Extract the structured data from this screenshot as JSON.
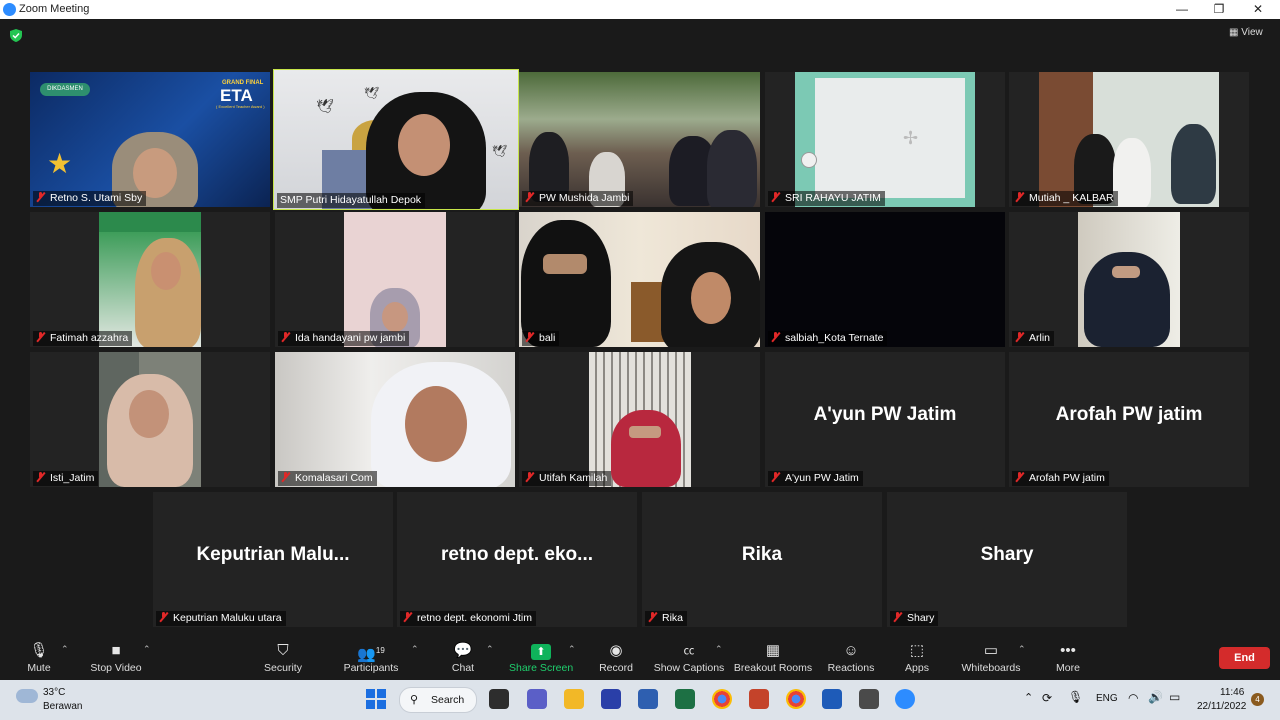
{
  "window": {
    "title": "Zoom Meeting",
    "min": "—",
    "max": "❐",
    "close": "✕"
  },
  "top": {
    "view_label": "View"
  },
  "tiles": [
    {
      "name": "Retno S. Utami Sby"
    },
    {
      "name": "SMP Putri Hidayatullah Depok"
    },
    {
      "name": "PW Mushida Jambi"
    },
    {
      "name": "SRI RAHAYU JATIM"
    },
    {
      "name": "Mutiah _ KALBAR"
    },
    {
      "name": "Fatimah azzahra"
    },
    {
      "name": "Ida handayani pw jambi"
    },
    {
      "name": "bali"
    },
    {
      "name": "salbiah_Kota Ternate"
    },
    {
      "name": "Arlin"
    },
    {
      "name": "Isti_Jatim"
    },
    {
      "name": "Komalasari Com"
    },
    {
      "name": "Utifah Kamilah"
    },
    {
      "name": "A'yun PW Jatim",
      "display": "A'yun PW Jatim"
    },
    {
      "name": "Arofah PW jatim",
      "display": "Arofah PW jatim"
    },
    {
      "name": "Keputrian Maluku utara",
      "display": "Keputrian  Malu..."
    },
    {
      "name": "retno dept. ekonomi Jtim",
      "display": "retno  dept.  eko..."
    },
    {
      "name": "Rika",
      "display": "Rika"
    },
    {
      "name": "Shary",
      "display": "Shary"
    }
  ],
  "banner": {
    "brand": "DIKDASMEN",
    "grand_final": "GRAND FINAL",
    "eta": "ETA",
    "eta_sub": "( Excellent Teacher Award )"
  },
  "toolbar": {
    "mute": "Mute",
    "stop_video": "Stop Video",
    "security": "Security",
    "participants": "Participants",
    "participants_count": "19",
    "chat": "Chat",
    "share_screen": "Share Screen",
    "record": "Record",
    "show_captions": "Show Captions",
    "breakout_rooms": "Breakout Rooms",
    "reactions": "Reactions",
    "apps": "Apps",
    "whiteboards": "Whiteboards",
    "more": "More",
    "end": "End"
  },
  "taskbar": {
    "temp": "33°C",
    "weather": "Berawan",
    "search": "Search",
    "lang": "ENG",
    "time": "11:46",
    "date": "22/11/2022",
    "notif_count": "4"
  }
}
